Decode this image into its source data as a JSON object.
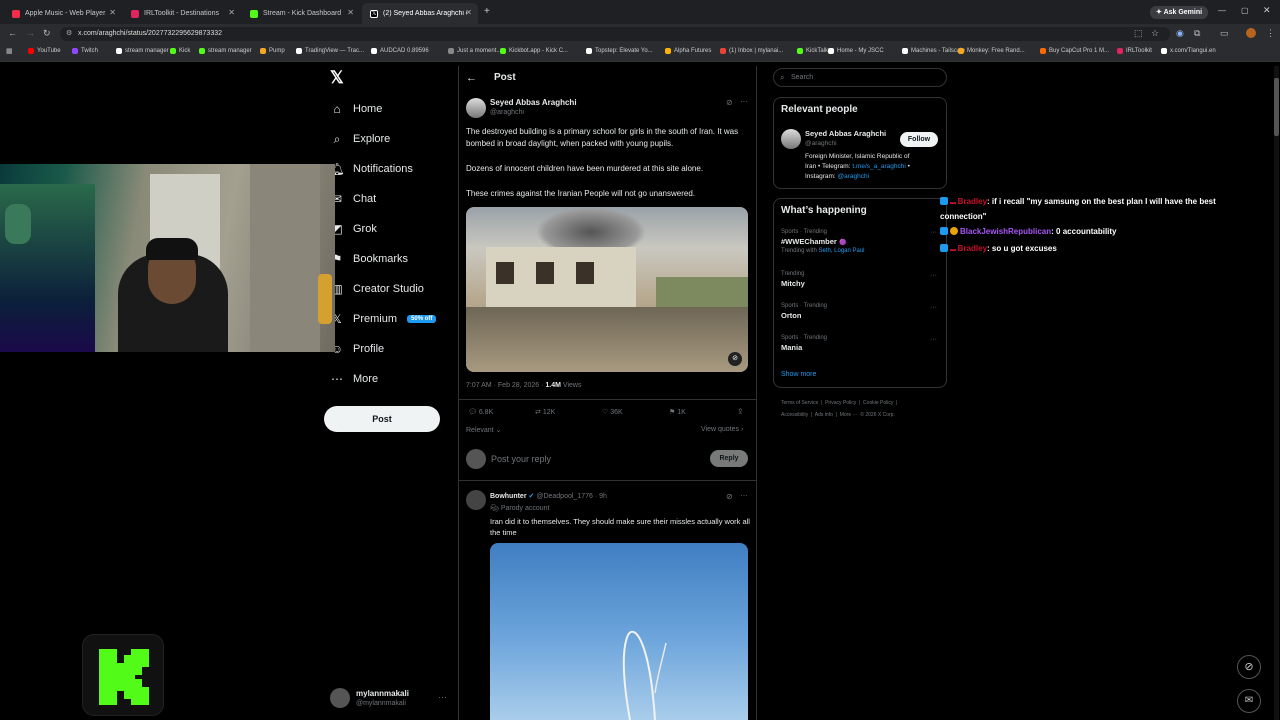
{
  "browser": {
    "tabs": [
      {
        "title": "Apple Music - Web Player",
        "color": "#fa2d48"
      },
      {
        "title": "IRLToolkit - Destinations",
        "color": "#e0245e"
      },
      {
        "title": "Stream - Kick Dashboard",
        "color": "#53fc18"
      },
      {
        "title": "(2) Seyed Abbas Araghchi on X",
        "color": "#ffffff"
      }
    ],
    "new_tab": "+",
    "ask_gemini": "Ask Gemini",
    "url": "x.com/araghchi/status/2027732295629873332",
    "bookmarks": [
      "YouTube",
      "Twitch",
      "stream manager",
      "Kick",
      "stream manager",
      "Pump",
      "TradingView — Trac...",
      "AUDCAD 0.89596",
      "Just a moment...",
      "Kickbot.app - Kick C...",
      "Topstep: Elevate Yo...",
      "Alpha Futures",
      "(1) Inbox | mylanai...",
      "KickTalk",
      "Home - My JSCC",
      "Machines - Tailscale",
      "Monkey: Free Rand...",
      "Buy CapCut Pro 1 M...",
      "IRLToolkit",
      "x.com/Tlangui.en"
    ]
  },
  "x": {
    "logo": "X",
    "nav": [
      "Home",
      "Explore",
      "Notifications",
      "Chat",
      "Grok",
      "Bookmarks",
      "Creator Studio",
      "Premium",
      "Profile",
      "More"
    ],
    "premium_badge": "50% off",
    "post_button": "Post",
    "account": {
      "name": "mylannmakali",
      "handle": "@mylannmakali"
    }
  },
  "post": {
    "header": "Post",
    "author": "Seyed Abbas Araghchi",
    "handle": "@araghchi",
    "para1": "The destroyed building is a primary school for girls in the south of Iran. It was bombed in broad daylight, when packed with young pupils.",
    "para2": "Dozens of innocent children have been murdered at this site alone.",
    "para3": "These crimes against the Iranian People will not go unanswered.",
    "timestamp": "7:07 AM · Feb 28, 2026 ·",
    "views": "1.4M",
    "views_label": "Views",
    "replies": "6.8K",
    "reposts": "12K",
    "likes": "36K",
    "bookmarks": "1K",
    "sort": "Relevant",
    "view_quotes": "View quotes",
    "reply_placeholder": "Post your reply",
    "reply_button": "Reply"
  },
  "reply": {
    "author": "Bowhunter",
    "handle": "@Deadpool_1776 · 9h",
    "label": "Parody account",
    "text": "Iran did it to themselves. They should make sure their missles actually work all the time"
  },
  "sidebar": {
    "search_placeholder": "Search",
    "relevant_title": "Relevant people",
    "person_name": "Seyed Abbas Araghchi",
    "person_handle": "@araghchi",
    "follow": "Follow",
    "bio1": "Foreign Minister, Islamic Republic of",
    "bio2": "Iran • Telegram:",
    "bio_link": "t.me/s_a_araghchi",
    "bio3": "•",
    "bio4": "Instagram:",
    "bio_link2": "@araghchi",
    "happening_title": "What’s happening",
    "trends": [
      {
        "meta": "Sports · Trending",
        "name": "#WWEChamber",
        "extra_prefix": "Trending with",
        "extra_links": "Seth, Logan Paul"
      },
      {
        "meta": "Trending",
        "name": "Mitchy"
      },
      {
        "meta": "Sports · Trending",
        "name": "Orton"
      },
      {
        "meta": "Sports · Trending",
        "name": "Mania"
      }
    ],
    "show_more": "Show more",
    "footer1": "Terms of Service  |  Privacy Policy  |  Cookie Policy  |",
    "footer2": "Accessibility  |  Ads info  |  More ···  © 2026 X Corp."
  },
  "chat": [
    {
      "user": "Bradley",
      "msg": ": if i recall \"my samsung on the best plan I will have the best connection\"",
      "color": "#c8102e"
    },
    {
      "user": "BlackJewishRepublican",
      "msg": ": 0 accountability",
      "color": "#a855f7"
    },
    {
      "user": "Bradley",
      "msg": ": so u got excuses",
      "color": "#c8102e"
    }
  ],
  "kick_logo": "K",
  "colors": {
    "accent": "#1d9bf0",
    "kick": "#53fc18",
    "bg": "#000000"
  }
}
